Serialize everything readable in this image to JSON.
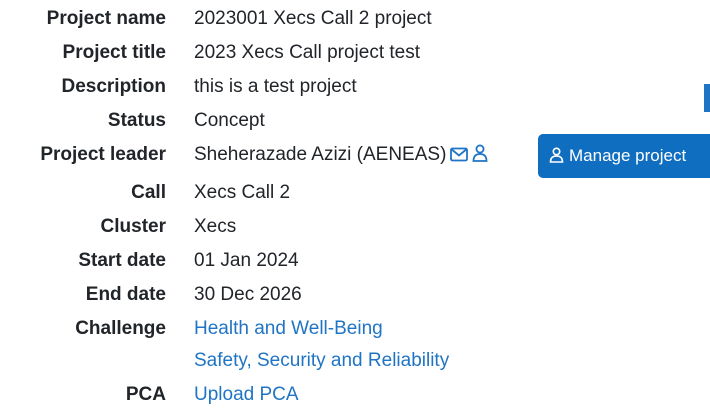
{
  "project": {
    "fields": [
      {
        "label": "Project name",
        "value": "2023001 Xecs Call 2 project"
      },
      {
        "label": "Project title",
        "value": "2023 Xecs Call project test"
      },
      {
        "label": "Description",
        "value": "this is a test project"
      },
      {
        "label": "Status",
        "value": "Concept"
      },
      {
        "label": "Project leader",
        "value": "Sheherazade Azizi (AENEAS)"
      },
      {
        "label": "Call",
        "value": "Xecs Call 2"
      },
      {
        "label": "Cluster",
        "value": "Xecs"
      },
      {
        "label": "Start date",
        "value": "01 Jan 2024"
      },
      {
        "label": "End date",
        "value": "30 Dec 2026"
      },
      {
        "label": "Challenge",
        "values": [
          "Health and Well-Being",
          "Safety, Security and Reliability"
        ]
      },
      {
        "label": "PCA",
        "value": "Upload PCA"
      }
    ],
    "manage_button_label": "Manage project",
    "icons": {
      "leader_mail": "envelope-icon",
      "leader_profile": "user-icon",
      "manage": "user-icon"
    },
    "colors": {
      "link": "#1f74c4",
      "button": "#0f6ec0",
      "text": "#212529"
    }
  }
}
